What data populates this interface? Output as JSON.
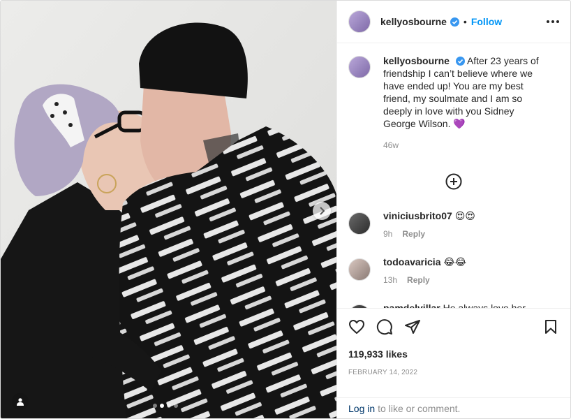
{
  "post": {
    "username": "kellyosbourne",
    "follow_label": "Follow",
    "separator": "•"
  },
  "caption": {
    "username": "kellyosbourne",
    "text": "After 23 years of friendship I can’t believe where we have ended up! You are my best friend, my soulmate and I am so deeply in love with you Sidney George Wilson. 💜",
    "time": "46w"
  },
  "comments": [
    {
      "username": "viniciusbrito07",
      "text": "😍😍",
      "time": "9h",
      "reply": "Reply"
    },
    {
      "username": "todoavaricia",
      "text": "😂😂",
      "time": "13h",
      "reply": "Reply"
    },
    {
      "username": "pamdelvillar",
      "text": "He always love her secretly😮😍",
      "time": "",
      "reply": ""
    }
  ],
  "likes": "119,933 likes",
  "date": "FEBRUARY 14, 2022",
  "login": {
    "link": "Log in",
    "rest": "to like or comment."
  },
  "carousel": {
    "slides": 4,
    "active_index": 1
  },
  "colors": {
    "accent": "#0095f6",
    "verified": "#3897f0",
    "link": "#00376b",
    "muted": "#8e8e8e"
  }
}
